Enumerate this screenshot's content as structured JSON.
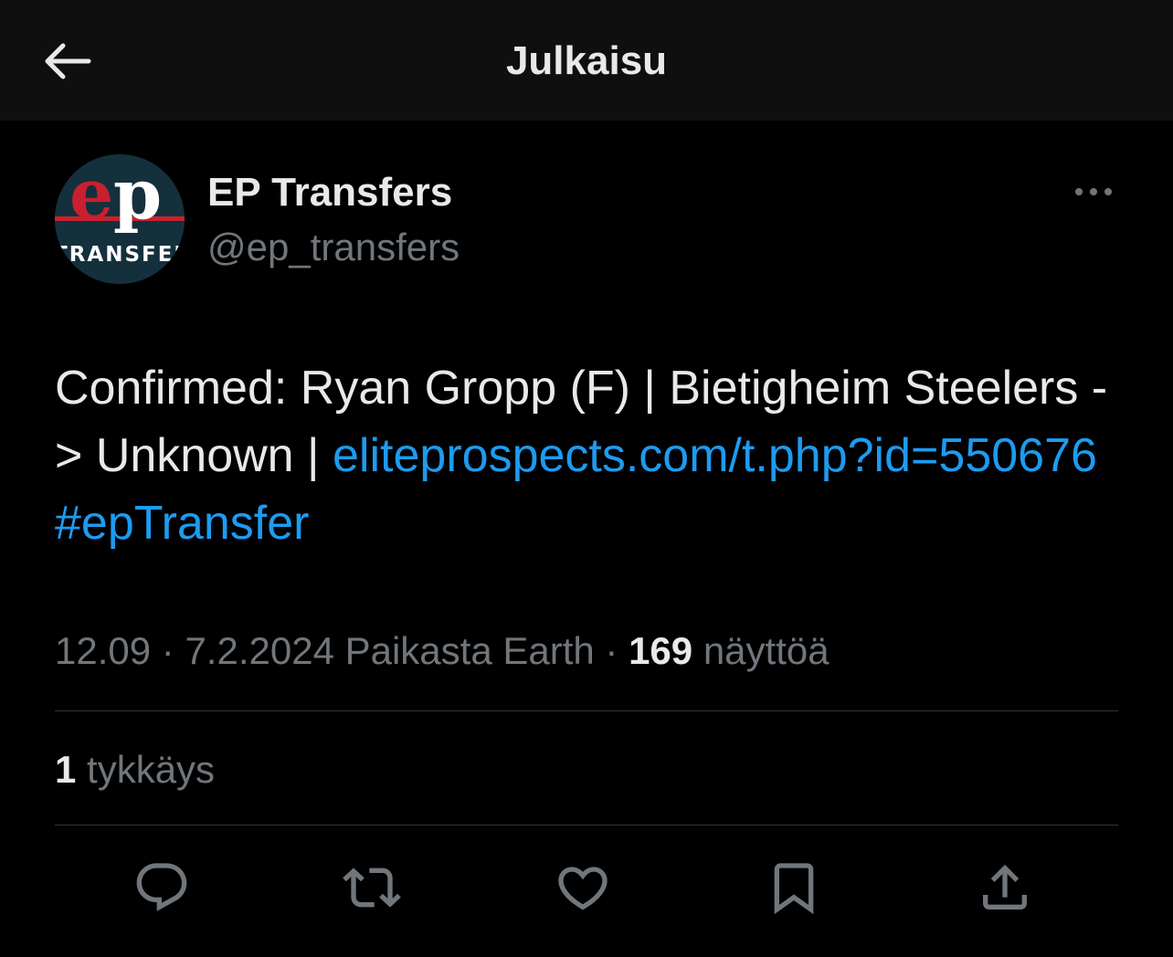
{
  "header": {
    "title": "Julkaisu",
    "back_icon": "arrow-left-icon"
  },
  "author": {
    "name": "EP Transfers",
    "handle": "@ep_transfers",
    "avatar": {
      "logo_text": "ep",
      "logo_subtext": "TRANSFERS",
      "colors": {
        "background": "#14303d",
        "e": "#c8202f",
        "p": "#ffffff",
        "stripe": "#c8202f"
      }
    }
  },
  "tweet": {
    "text_before": "Confirmed: Ryan Gropp (F) | Bietigheim Steelers -> Unknown | ",
    "link": "eliteprospects.com/t.php?id=550676",
    "text_between": " ",
    "hashtag": "#epTransfer"
  },
  "meta": {
    "time": "12.09",
    "separator1": " · ",
    "date": "7.2.2024",
    "location": " Paikasta Earth",
    "separator2": " · ",
    "views_count": "169",
    "views_label": " näyttöä"
  },
  "stats": {
    "likes_count": "1",
    "likes_label": " tykkäys"
  },
  "actions": [
    {
      "name": "reply",
      "icon": "reply-icon"
    },
    {
      "name": "repost",
      "icon": "repost-icon"
    },
    {
      "name": "like",
      "icon": "heart-icon"
    },
    {
      "name": "bookmark",
      "icon": "bookmark-icon"
    },
    {
      "name": "share",
      "icon": "share-icon"
    }
  ],
  "colors": {
    "background": "#000000",
    "header_background": "#0f0f0f",
    "text_primary": "#e7e9ea",
    "text_secondary": "#71767b",
    "link": "#1d9bf0",
    "divider": "#2f3336"
  }
}
